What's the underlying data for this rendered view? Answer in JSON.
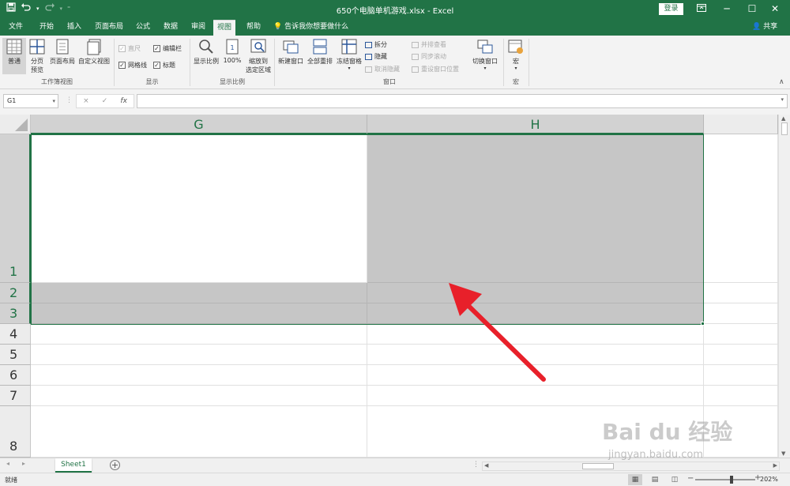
{
  "titlebar": {
    "title": "650个电脑单机游戏.xlsx  -  Excel",
    "login_label": "登录",
    "qat_icons": [
      "save-icon",
      "undo-icon",
      "redo-icon",
      "customize-icon"
    ]
  },
  "tabs": {
    "items": [
      "文件",
      "开始",
      "插入",
      "页面布局",
      "公式",
      "数据",
      "审阅",
      "视图",
      "帮助"
    ],
    "active": "视图",
    "tellme": "告诉我你想要做什么",
    "share": "共享"
  },
  "ribbon": {
    "workbook_views": {
      "group_label": "工作簿视图",
      "normal": "普通",
      "page_break_line1": "分页",
      "page_break_line2": "预览",
      "page_layout": "页面布局",
      "custom_views": "自定义视图"
    },
    "show": {
      "group_label": "显示",
      "ruler": "直尺",
      "formula_bar": "编辑栏",
      "gridlines": "网格线",
      "headings": "标题"
    },
    "zoom": {
      "group_label": "显示比例",
      "zoom": "显示比例",
      "hundred": "100%",
      "zoom_selection_line1": "缩放到",
      "zoom_selection_line2": "选定区域"
    },
    "window": {
      "group_label": "窗口",
      "new_window": "新建窗口",
      "arrange_all": "全部重排",
      "freeze_panes": "冻结窗格",
      "split": "拆分",
      "hide": "隐藏",
      "unhide": "取消隐藏",
      "side_by_side": "并排查看",
      "sync_scroll": "同步滚动",
      "reset_position": "重设窗口位置",
      "switch_windows": "切换窗口"
    },
    "macros": {
      "group_label": "宏",
      "macros": "宏"
    }
  },
  "formula_bar": {
    "name_box": "G1",
    "cancel_icon": "×",
    "enter_icon": "✓",
    "fx_label": "fx",
    "value": ""
  },
  "grid": {
    "columns": [
      "G",
      "H"
    ],
    "rows": [
      "1",
      "2",
      "3",
      "4",
      "5",
      "6",
      "7",
      "8"
    ],
    "selected_range": "G1:H3"
  },
  "sheets": {
    "tabs": [
      "Sheet1"
    ],
    "active": "Sheet1"
  },
  "status": {
    "ready": "就绪",
    "zoom": "202%"
  },
  "watermark": {
    "brand": "Bai du 经验",
    "url": "jingyan.baidu.com"
  },
  "colors": {
    "accent": "#217346",
    "selection": "#c6c6c6",
    "arrow": "#e8202a"
  }
}
